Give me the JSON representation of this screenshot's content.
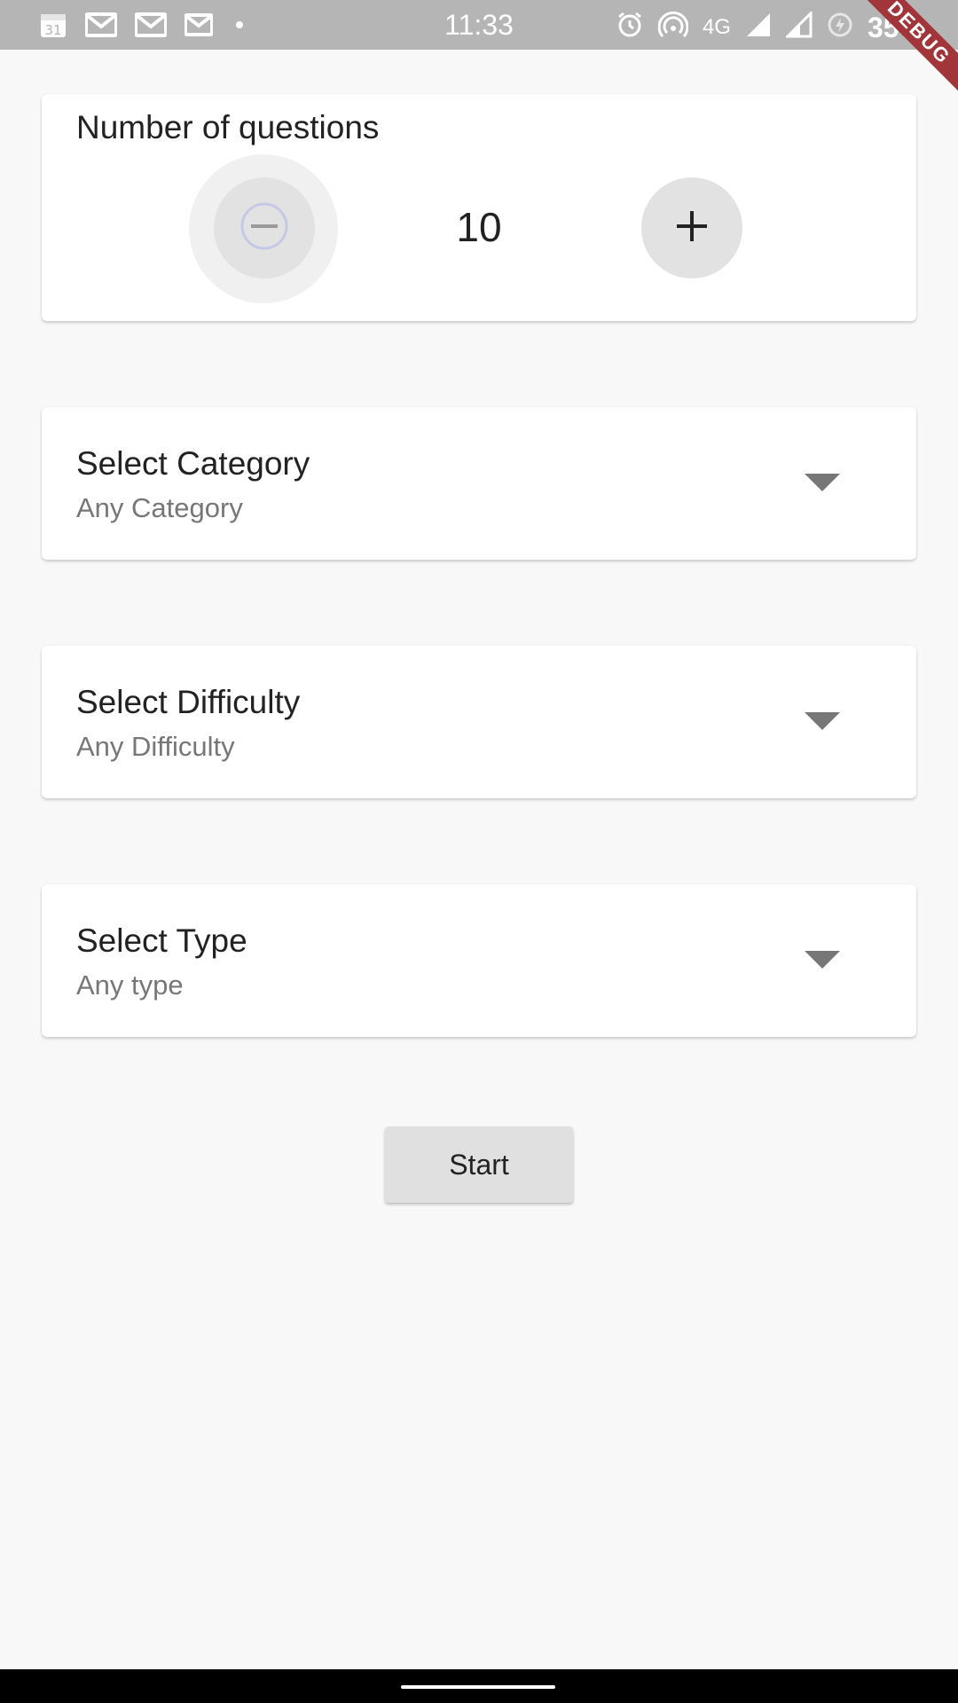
{
  "status_bar": {
    "time": "11:33",
    "calendar_day": "31",
    "network": "4G",
    "battery": "35%"
  },
  "debug_banner": {
    "label": "DEBUG"
  },
  "questions_card": {
    "label": "Number of questions",
    "value": "10",
    "decrement_icon": "minus-circle-icon",
    "increment_icon": "plus-icon"
  },
  "category": {
    "title": "Select Category",
    "value": "Any Category"
  },
  "difficulty": {
    "title": "Select Difficulty",
    "value": "Any Difficulty"
  },
  "type": {
    "title": "Select Type",
    "value": "Any type"
  },
  "start_button": {
    "label": "Start"
  },
  "colors": {
    "background": "#f8f8f8",
    "status_bar": "#b5b5b5",
    "debug_banner": "#a2353a",
    "button": "#e0e0e0",
    "secondary_text": "#777777"
  }
}
